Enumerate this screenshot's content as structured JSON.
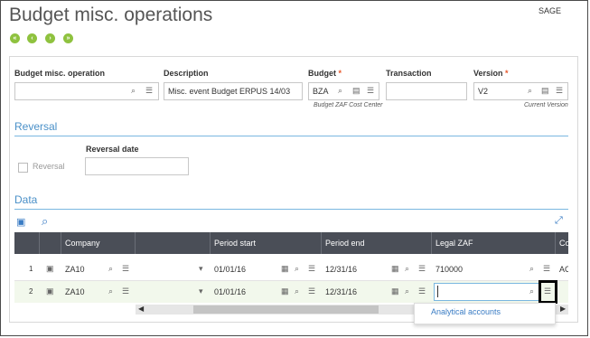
{
  "page": {
    "title": "Budget misc. operations",
    "brand": "SAGE"
  },
  "nav": {
    "first": "◀◀",
    "prev": "◀",
    "next": "▶",
    "last": "▶▶"
  },
  "header": {
    "budget_misc_operation": {
      "label": "Budget misc. operation",
      "value": ""
    },
    "description": {
      "label": "Description",
      "value": "Misc. event Budget ERPUS 14/03"
    },
    "budget": {
      "label": "Budget",
      "required": "*",
      "value": "BZA",
      "subtext": "Budget ZAF Cost Center"
    },
    "transaction": {
      "label": "Transaction",
      "value": ""
    },
    "version": {
      "label": "Version",
      "required": "*",
      "value": "V2",
      "subtext": "Current Version"
    }
  },
  "reversal": {
    "section_title": "Reversal",
    "checkbox_label": "Reversal",
    "date_label": "Reversal date",
    "date_value": ""
  },
  "data": {
    "section_title": "Data",
    "columns": [
      "",
      "",
      "Company",
      "",
      "Period start",
      "Period end",
      "Legal ZAF",
      "Co"
    ],
    "rows": [
      {
        "num": "1",
        "company": "ZA10",
        "period_start": "01/01/16",
        "period_end": "12/31/16",
        "legal": "710000",
        "extra": "AC"
      },
      {
        "num": "2",
        "company": "ZA10",
        "period_start": "01/01/16",
        "period_end": "12/31/16",
        "legal": "",
        "extra": ""
      }
    ],
    "popup_item": "Analytical accounts"
  },
  "icons": {
    "search": "🔍",
    "list": "☰",
    "calendar": "📅",
    "dropdown": "▾",
    "expand": "⤢",
    "scroll_left": "◀",
    "scroll_right": "▶"
  },
  "colors": {
    "accent": "#4a90c8",
    "required": "#e8572a",
    "nav": "#8fc23f",
    "table_header": "#4a4e57"
  }
}
